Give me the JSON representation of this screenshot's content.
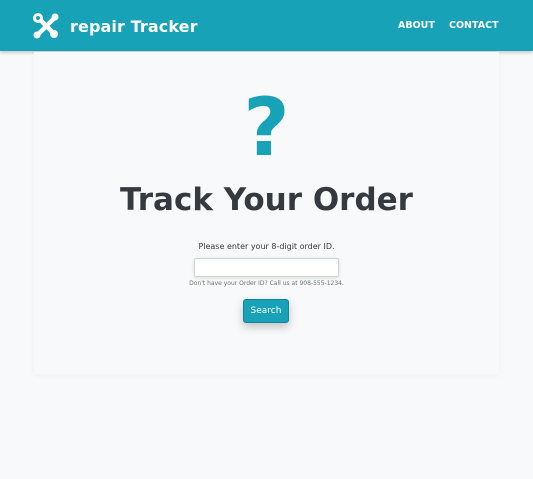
{
  "navbar": {
    "brand_icon": "tools-icon",
    "brand_name": "repair Tracker",
    "links": [
      "ABOUT",
      "CONTACT"
    ],
    "background_color": "#17a2b8"
  },
  "main": {
    "hero_icon": "question-mark-icon",
    "hero_glyph": "?",
    "title": "Track Your Order",
    "prompt": "Please enter your 8-digit order ID.",
    "order_input": {
      "value": "",
      "placeholder": ""
    },
    "help_text": "Don't have your Order ID? Call us at 908-555-1234.",
    "search_label": "Search",
    "accent_color": "#17a2b8"
  }
}
